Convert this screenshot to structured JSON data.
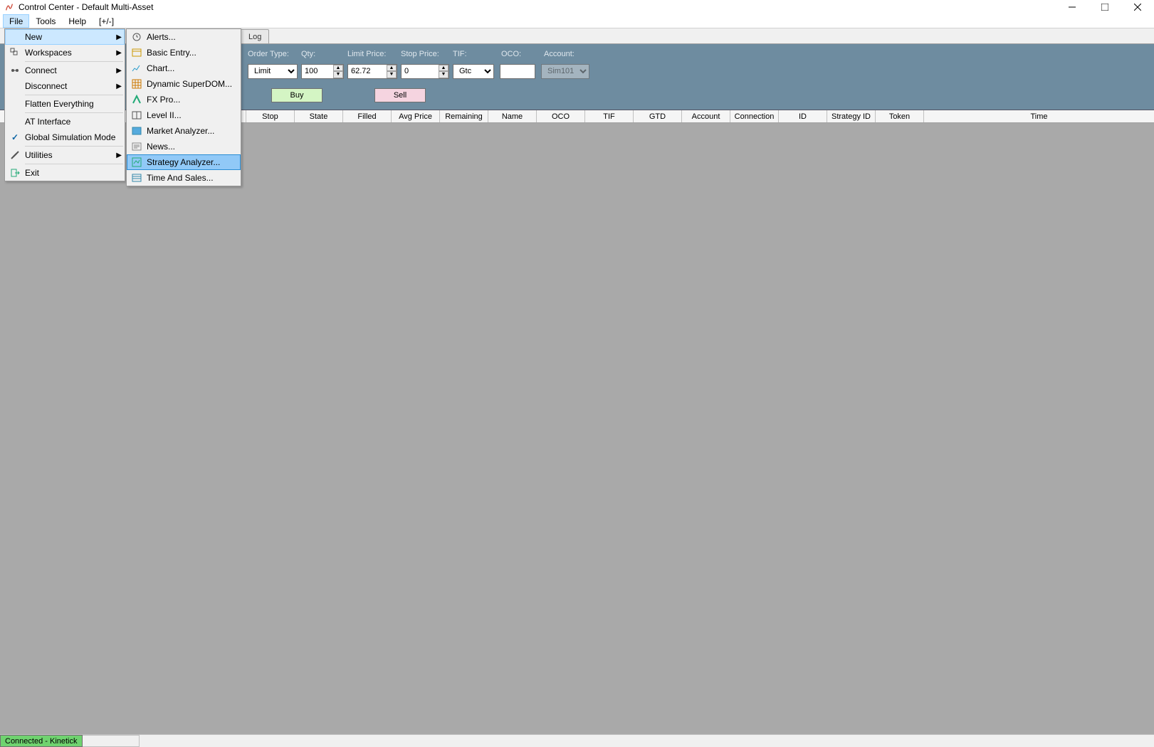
{
  "title": "Control Center - Default Multi-Asset",
  "menubar": [
    "File",
    "Tools",
    "Help",
    "[+/-]"
  ],
  "file_menu": {
    "new": "New",
    "workspaces": "Workspaces",
    "connect": "Connect",
    "disconnect": "Disconnect",
    "flatten": "Flatten Everything",
    "atinterface": "AT Interface",
    "simmode": "Global Simulation Mode",
    "utilities": "Utilities",
    "exit": "Exit"
  },
  "new_menu": {
    "alerts": "Alerts...",
    "basicentry": "Basic Entry...",
    "chart": "Chart...",
    "superdom": "Dynamic SuperDOM...",
    "fxpro": "FX Pro...",
    "level2": "Level II...",
    "marketanalyzer": "Market Analyzer...",
    "news": "News...",
    "strategyanalyzer": "Strategy Analyzer...",
    "timeandsales": "Time And Sales..."
  },
  "tabs": {
    "log": "Log"
  },
  "order": {
    "labels": {
      "ordertype": "Order Type:",
      "qty": "Qty:",
      "limitprice": "Limit Price:",
      "stopprice": "Stop Price:",
      "tif": "TIF:",
      "oco": "OCO:",
      "account": "Account:"
    },
    "values": {
      "ordertype": "Limit",
      "qty": "100",
      "limitprice": "62.72",
      "stopprice": "0",
      "tif": "Gtc",
      "oco": "",
      "account": "Sim101"
    },
    "buy": "Buy",
    "sell": "Sell"
  },
  "grid_columns": [
    "Stop",
    "State",
    "Filled",
    "Avg Price",
    "Remaining",
    "Name",
    "OCO",
    "TIF",
    "GTD",
    "Account",
    "Connection",
    "ID",
    "Strategy ID",
    "Token",
    "Time"
  ],
  "status": "Connected - Kinetick"
}
